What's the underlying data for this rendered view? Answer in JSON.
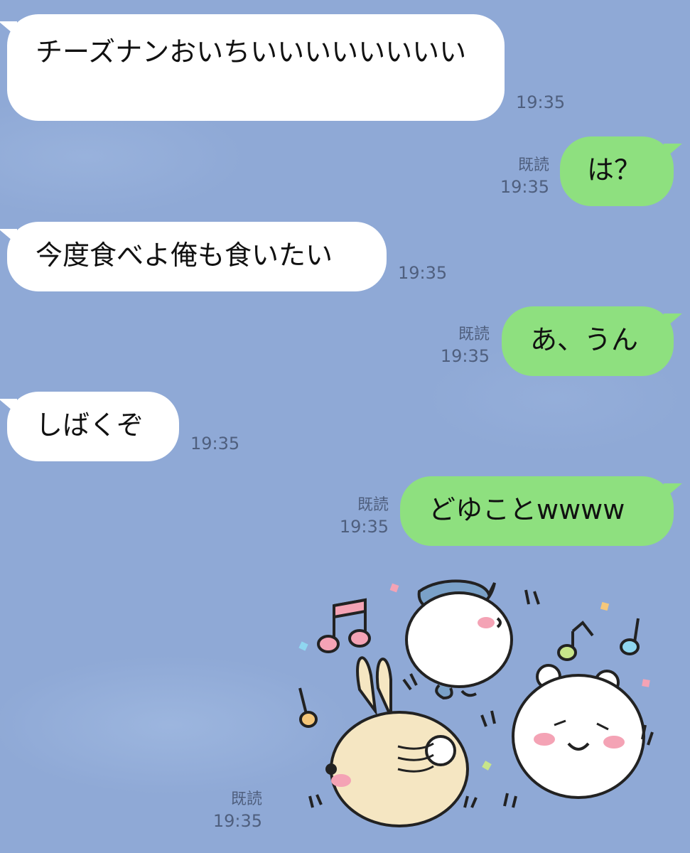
{
  "messages": [
    {
      "side": "in",
      "text": "チーズナンおいちいいいいいいいい",
      "time": "19:35"
    },
    {
      "side": "out",
      "text": "は？",
      "read": "既読",
      "time": "19:35"
    },
    {
      "side": "in",
      "text": "今度食べよ俺も食いたい",
      "time": "19:35"
    },
    {
      "side": "out",
      "text": "あ、うん",
      "read": "既読",
      "time": "19:35"
    },
    {
      "side": "in",
      "text": "しばくぞ",
      "time": "19:35"
    },
    {
      "side": "out",
      "text": "どゆことwwww",
      "read": "既読",
      "time": "19:35"
    },
    {
      "side": "out",
      "sticker": "dancing-characters-sticker",
      "read": "既読",
      "time": "19:35"
    }
  ],
  "colors": {
    "background": "#8fa9d6",
    "incoming": "#ffffff",
    "outgoing": "#8ee07f",
    "meta": "#4f5f7e"
  }
}
